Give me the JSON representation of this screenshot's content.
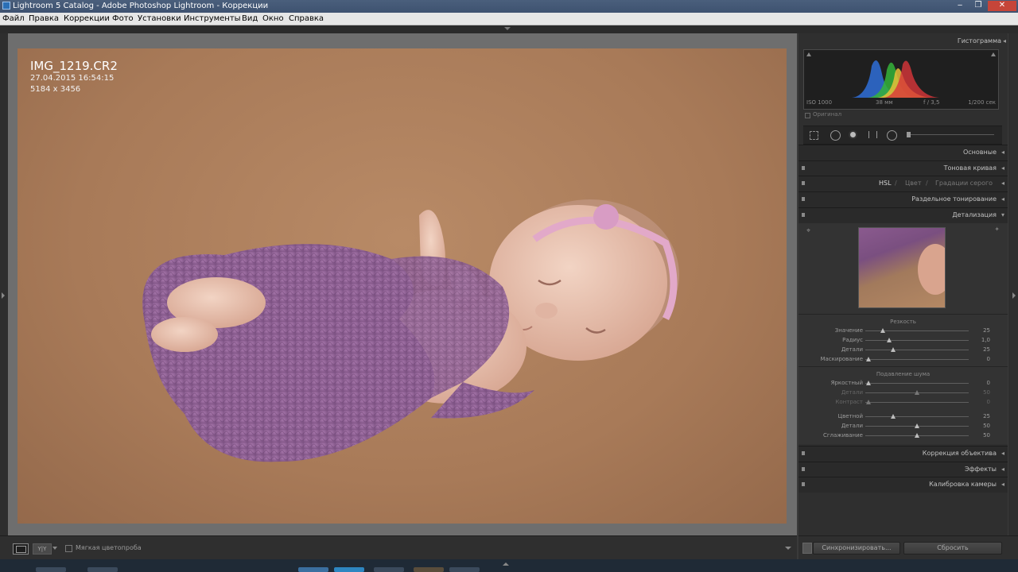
{
  "window": {
    "title": "Lightroom 5 Catalog - Adobe Photoshop Lightroom - Коррекции"
  },
  "menu": [
    "Файл",
    "Правка",
    "Коррекции",
    "Фото",
    "Установки",
    "Инструменты",
    "Вид",
    "Окно",
    "Справка"
  ],
  "photo_info": {
    "filename": "IMG_1219.CR2",
    "datetime": "27.04.2015 16:54:15",
    "dimensions": "5184 x 3456"
  },
  "histogram": {
    "title": "Гистограмма",
    "iso": "ISO 1000",
    "focal": "38 мм",
    "aperture": "f / 3,5",
    "shutter": "1/200 сек",
    "original_label": "Оригинал"
  },
  "panels": {
    "basic": "Основные",
    "tone_curve": "Тоновая кривая",
    "hsl": "HSL",
    "color": "Цвет",
    "grayscale": "Градации серого",
    "split_toning": "Раздельное тонирование",
    "detail": "Детализация",
    "lens_corrections": "Коррекция объектива",
    "effects": "Эффекты",
    "camera_calibration": "Калибровка камеры"
  },
  "sharpening": {
    "title": "Резкость",
    "sliders": [
      {
        "label": "Значение",
        "value": "25",
        "pos": 0.17
      },
      {
        "label": "Радиус",
        "value": "1,0",
        "pos": 0.23
      },
      {
        "label": "Детали",
        "value": "25",
        "pos": 0.27
      },
      {
        "label": "Маскирование",
        "value": "0",
        "pos": 0.03
      }
    ]
  },
  "noise": {
    "title": "Подавление шума",
    "sliders": [
      {
        "label": "Яркостный",
        "value": "0",
        "pos": 0.03,
        "dim": false
      },
      {
        "label": "Детали",
        "value": "50",
        "pos": 0.5,
        "dim": true
      },
      {
        "label": "Контраст",
        "value": "0",
        "pos": 0.03,
        "dim": true
      },
      {
        "label": "Цветной",
        "value": "25",
        "pos": 0.27,
        "dim": false
      },
      {
        "label": "Детали",
        "value": "50",
        "pos": 0.5,
        "dim": false
      },
      {
        "label": "Сглаживание",
        "value": "50",
        "pos": 0.5,
        "dim": false
      }
    ]
  },
  "toolbar": {
    "soft_proof": "Мягкая цветопроба"
  },
  "buttons": {
    "sync": "Синхронизировать...",
    "reset": "Сбросить"
  },
  "colors": {
    "panel_bg": "#2f2f2f",
    "center_bg": "#6e6e6e",
    "blanket": "#9a6a9e"
  }
}
